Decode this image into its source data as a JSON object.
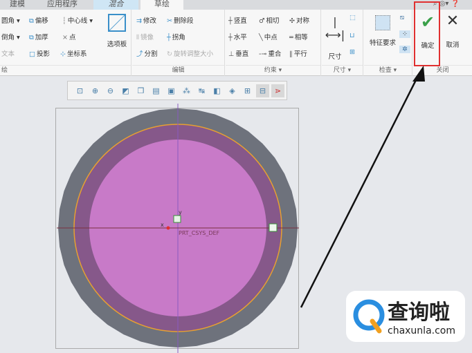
{
  "tabs": [
    "建模",
    "应用程序",
    "混合",
    "草绘"
  ],
  "groups": {
    "sketch": {
      "label": "绘",
      "items": [
        "圆角",
        "倒角",
        "文本",
        "偏移",
        "加厚",
        "投影",
        "中心线",
        "点",
        "坐标系",
        "选项板"
      ]
    },
    "edit": {
      "label": "编辑",
      "items": [
        "修改",
        "删除段",
        "镜像",
        "拐角",
        "分割",
        "旋转调整大小"
      ]
    },
    "constraint": {
      "label": "约束",
      "items": [
        "竖直",
        "水平",
        "垂直",
        "相切",
        "中点",
        "重合",
        "对称",
        "相等",
        "平行"
      ]
    },
    "dimension": {
      "label": "尺寸",
      "items": [
        "尺寸"
      ]
    },
    "inspect": {
      "label": "检查",
      "items": [
        "特征要求"
      ]
    },
    "close": {
      "label": "关闭",
      "ok": "确定",
      "cancel": "取消"
    }
  },
  "canvas": {
    "csys_label": "PRT_CSYS_DEF",
    "x_axis": "x",
    "y_axis": "y"
  },
  "watermark": {
    "name": "查询啦",
    "url": "chaxunla.com"
  },
  "colors": {
    "accent": "#e03030",
    "ok": "#3aa04a",
    "sketch_fill": "#c87ac8"
  }
}
